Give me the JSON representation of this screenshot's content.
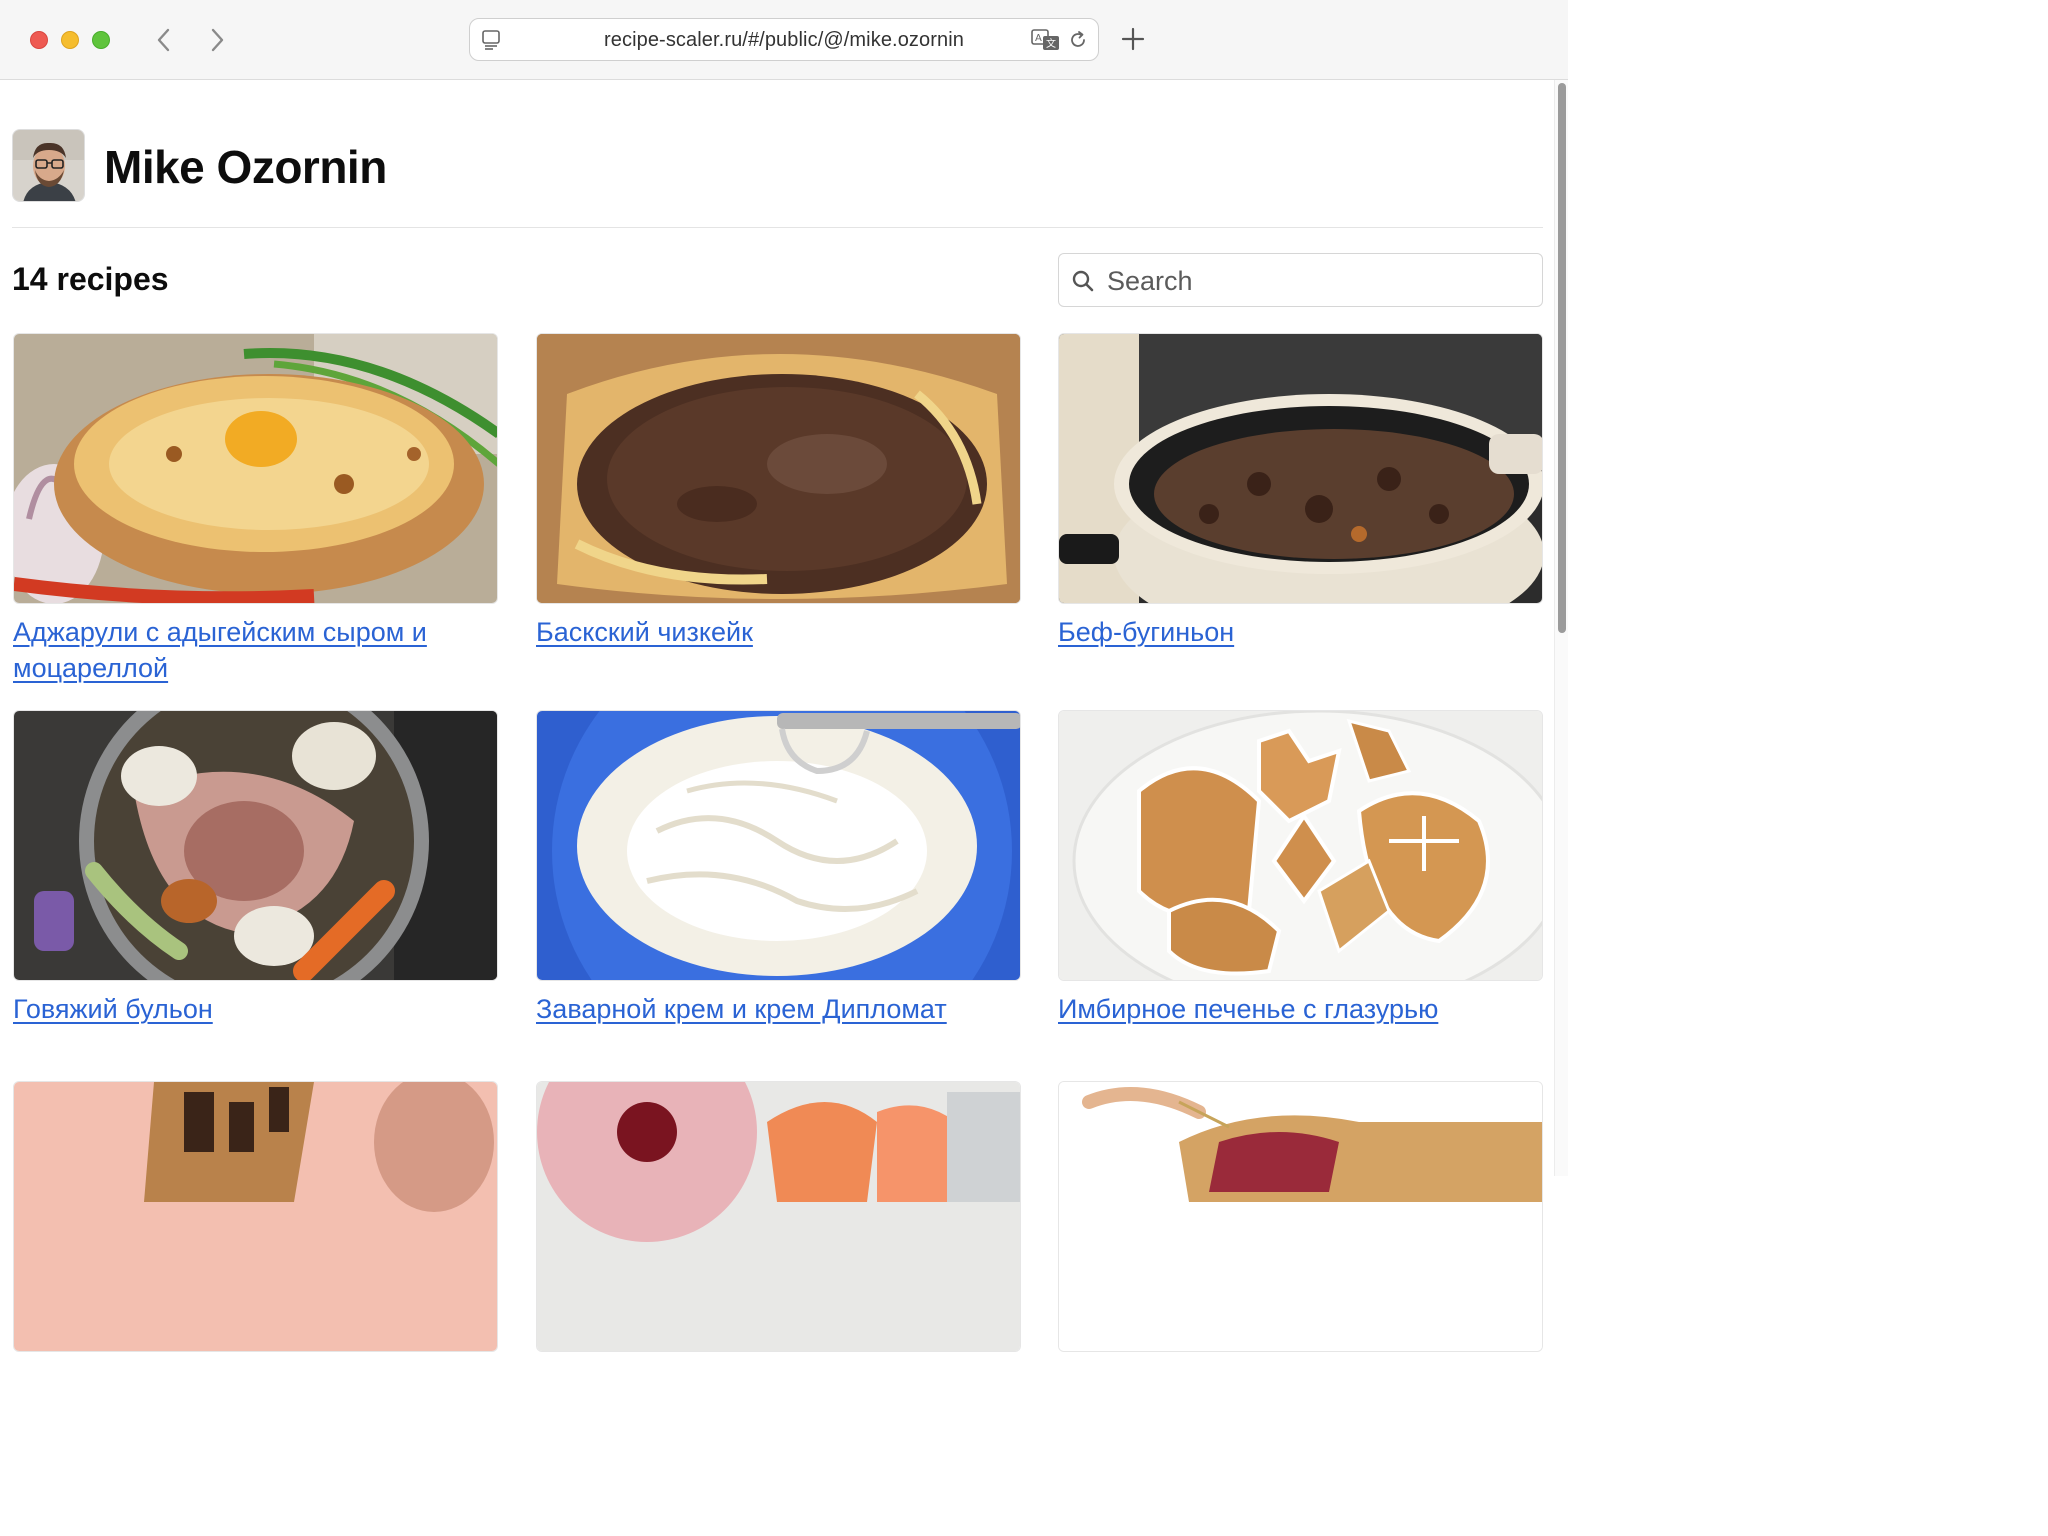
{
  "browser": {
    "url": "recipe-scaler.ru/#/public/@/mike.ozornin",
    "icons": [
      "reader-icon",
      "translate-icon",
      "reload-icon",
      "back-icon",
      "forward-icon",
      "new-tab-icon"
    ]
  },
  "profile": {
    "name": "Mike Ozornin"
  },
  "listing": {
    "count_label": "14 recipes",
    "search_placeholder": "Search"
  },
  "recipes": [
    {
      "title": "Аджарули с адыгейским сыром и моцареллой"
    },
    {
      "title": "Баскский чизкейк"
    },
    {
      "title": "Беф-бугиньон"
    },
    {
      "title": "Говяжий бульон"
    },
    {
      "title": "Заварной крем и крем Дипломат"
    },
    {
      "title": "Имбирное печенье с глазурью"
    },
    {
      "title": ""
    },
    {
      "title": ""
    },
    {
      "title": ""
    }
  ],
  "colors": {
    "link": "#2a63d4",
    "heading": "#0d0d0d"
  }
}
